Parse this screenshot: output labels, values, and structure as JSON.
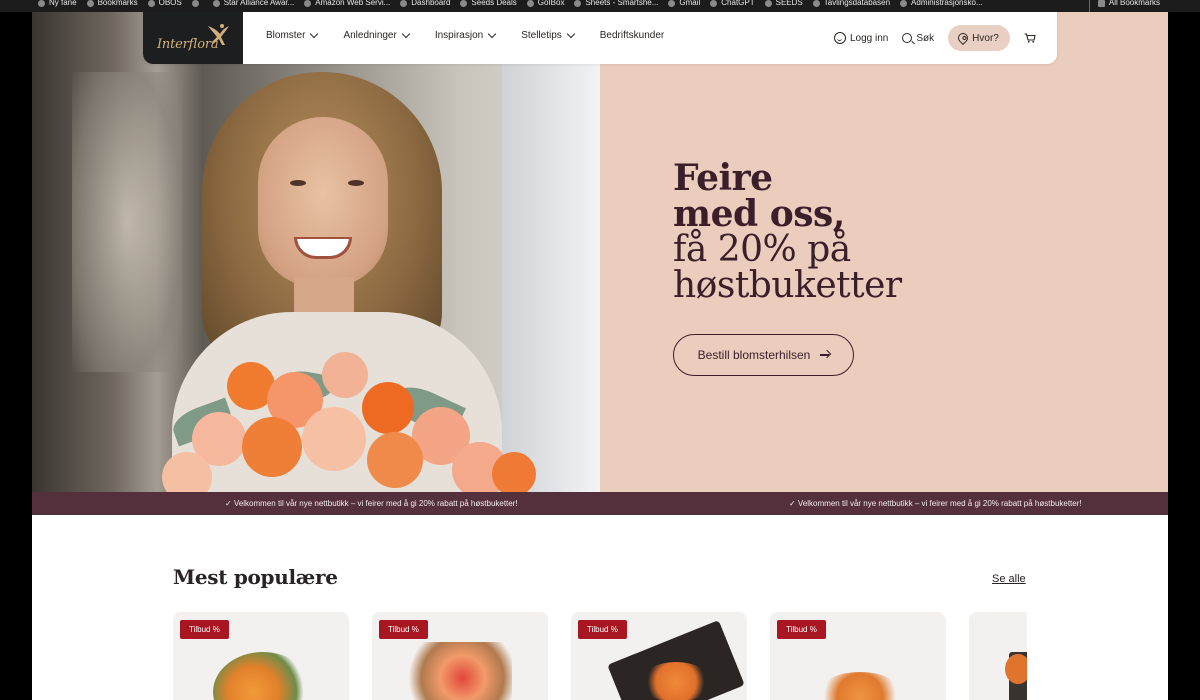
{
  "bookmarks": [
    {
      "label": "Ny fane",
      "icon": "new-tab-icon"
    },
    {
      "label": "Bookmarks",
      "icon": "star-icon"
    },
    {
      "label": "OBOS",
      "icon": "obos-icon"
    },
    {
      "label": "",
      "icon": "linkedin-icon"
    },
    {
      "label": "Star Alliance Awar...",
      "icon": "star-alliance-icon"
    },
    {
      "label": "Amazon Web Servi...",
      "icon": "aws-icon"
    },
    {
      "label": "Dashboard",
      "icon": "dashboard-icon"
    },
    {
      "label": "Seeds Deals",
      "icon": "seeds-icon"
    },
    {
      "label": "GoIBox",
      "icon": "goibox-icon"
    },
    {
      "label": "Sheets - Smartshe...",
      "icon": "smartsheet-icon"
    },
    {
      "label": "Gmail",
      "icon": "gmail-icon"
    },
    {
      "label": "ChatGPT",
      "icon": "chatgpt-icon"
    },
    {
      "label": "SEEDS",
      "icon": "seeds-icon"
    },
    {
      "label": "Tavlingsdatabasen",
      "icon": "database-icon"
    },
    {
      "label": "Administrasjonsko...",
      "icon": "admin-icon"
    }
  ],
  "all_bookmarks_label": "All Bookmarks",
  "header": {
    "logo": "Interflora",
    "nav": [
      {
        "label": "Blomster",
        "has_dropdown": true
      },
      {
        "label": "Anledninger",
        "has_dropdown": true
      },
      {
        "label": "Inspirasjon",
        "has_dropdown": true
      },
      {
        "label": "Stelletips",
        "has_dropdown": true
      },
      {
        "label": "Bedriftskunder",
        "has_dropdown": false
      }
    ],
    "login_label": "Logg inn",
    "search_label": "Søk",
    "location_label": "Hvor?",
    "cart_icon": "cart-icon"
  },
  "hero": {
    "title_line1": "Feire",
    "title_line2": "med oss,",
    "title_line3": "få 20% på",
    "title_line4": "høstbuketter",
    "cta_label": "Bestill blomsterhilsen"
  },
  "ticker": {
    "message_1": "✓ Velkommen til vår nye nettbutikk – vi feirer med å gi 20% rabatt på høstbuketter!",
    "message_2": "✓ Velkommen til vår nye nettbutikk – vi feirer med å gi 20% rabatt på høstbuketter!"
  },
  "popular": {
    "title": "Mest populære",
    "see_all_label": "Se alle",
    "cards": [
      {
        "badge": "Tilbud %"
      },
      {
        "badge": "Tilbud %"
      },
      {
        "badge": "Tilbud %"
      },
      {
        "badge": "Tilbud %"
      },
      {
        "badge": ""
      }
    ]
  },
  "colors": {
    "hero_bg": "#eacdbd",
    "ticker_bg": "#54303c",
    "brand_dark": "#3a1f2b",
    "badge_red": "#a81621",
    "logo_gold": "#d1b07c"
  }
}
